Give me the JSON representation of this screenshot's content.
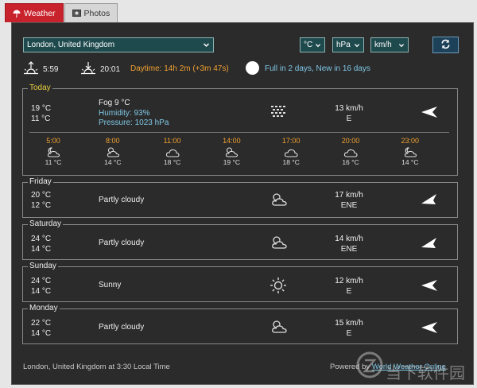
{
  "tabs": [
    {
      "label": "Weather",
      "icon": "umbrella-icon",
      "active": true
    },
    {
      "label": "Photos",
      "icon": "photo-icon",
      "active": false
    }
  ],
  "controls": {
    "location": "London, United Kingdom",
    "temp_unit": "°C",
    "pressure_unit": "hPa",
    "speed_unit": "km/h",
    "refresh_icon": "refresh-icon"
  },
  "sun": {
    "sunrise": "5:59",
    "sunset": "20:01",
    "daytime": "Daytime: 14h 2m (+3m 47s)",
    "moon": "Full in 2 days, New in 16 days"
  },
  "today": {
    "label": "Today",
    "high": "19 °C",
    "low": "11 °C",
    "condition": "Fog 9 °C",
    "humidity": "Humidity: 93%",
    "pressure": "Pressure: 1023 hPa",
    "icon": "fog-icon",
    "wind_speed": "13 km/h",
    "wind_dir": "E",
    "hourly": [
      {
        "time": "5:00",
        "temp": "11 °C",
        "icon": "partly-cloudy-night-icon"
      },
      {
        "time": "8:00",
        "temp": "14 °C",
        "icon": "partly-cloudy-icon"
      },
      {
        "time": "11:00",
        "temp": "18 °C",
        "icon": "cloudy-icon"
      },
      {
        "time": "14:00",
        "temp": "19 °C",
        "icon": "partly-cloudy-icon"
      },
      {
        "time": "17:00",
        "temp": "18 °C",
        "icon": "cloudy-icon"
      },
      {
        "time": "20:00",
        "temp": "16 °C",
        "icon": "cloudy-icon"
      },
      {
        "time": "23:00",
        "temp": "14 °C",
        "icon": "partly-cloudy-night-icon"
      }
    ]
  },
  "days": [
    {
      "label": "Friday",
      "high": "20 °C",
      "low": "12 °C",
      "condition": "Partly cloudy",
      "icon": "partly-cloudy-icon",
      "wind_speed": "17 km/h",
      "wind_dir": "ENE"
    },
    {
      "label": "Saturday",
      "high": "24 °C",
      "low": "14 °C",
      "condition": "Partly cloudy",
      "icon": "partly-cloudy-icon",
      "wind_speed": "14 km/h",
      "wind_dir": "ENE"
    },
    {
      "label": "Sunday",
      "high": "24 °C",
      "low": "14 °C",
      "condition": "Sunny",
      "icon": "sunny-icon",
      "wind_speed": "12 km/h",
      "wind_dir": "E"
    },
    {
      "label": "Monday",
      "high": "22 °C",
      "low": "14 °C",
      "condition": "Partly cloudy",
      "icon": "partly-cloudy-icon",
      "wind_speed": "15 km/h",
      "wind_dir": "E"
    }
  ],
  "footer": {
    "local_time": "London, United Kingdom at 3:30 Local Time",
    "powered_by": "Powered by",
    "provider": "World Weather Online"
  },
  "watermark": "当下软件园",
  "colors": {
    "accent_red": "#c8232c",
    "panel_bg": "#2b2b2b",
    "orange": "#f0a030",
    "blue": "#7fc7e6",
    "today_label": "#e8d040"
  }
}
